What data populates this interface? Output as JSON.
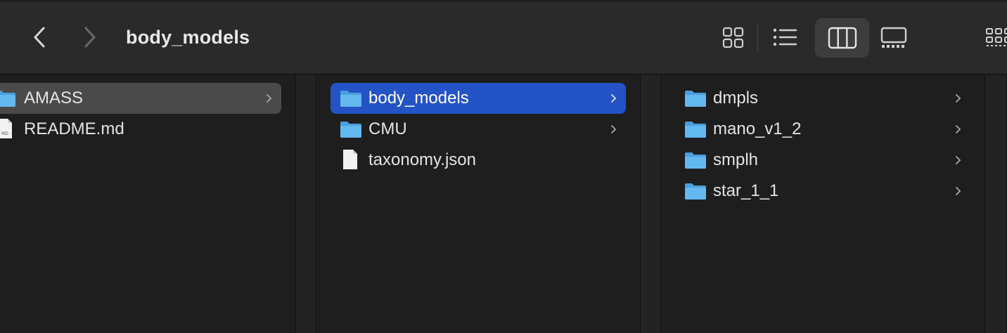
{
  "window": {
    "title": "body_models"
  },
  "columns": [
    {
      "items": [
        {
          "label": "AMASS",
          "type": "folder",
          "has_children": true,
          "selected": "inactive"
        },
        {
          "label": "README.md",
          "type": "file",
          "badge": "MD",
          "has_children": false
        }
      ]
    },
    {
      "items": [
        {
          "label": "body_models",
          "type": "folder",
          "has_children": true,
          "selected": "active"
        },
        {
          "label": "CMU",
          "type": "folder",
          "has_children": true
        },
        {
          "label": "taxonomy.json",
          "type": "file",
          "has_children": false
        }
      ]
    },
    {
      "items": [
        {
          "label": "dmpls",
          "type": "folder",
          "has_children": true
        },
        {
          "label": "mano_v1_2",
          "type": "folder",
          "has_children": true
        },
        {
          "label": "smplh",
          "type": "folder",
          "has_children": true
        },
        {
          "label": "star_1_1",
          "type": "folder",
          "has_children": true
        }
      ]
    }
  ],
  "toolbar": {
    "view_modes": [
      "icon-view",
      "list-view",
      "column-view",
      "gallery-view"
    ],
    "active_view": "column-view"
  },
  "colors": {
    "accent_selection": "#2453c5",
    "inactive_selection": "#4a4a4a",
    "folder": "#5eb4ee"
  }
}
